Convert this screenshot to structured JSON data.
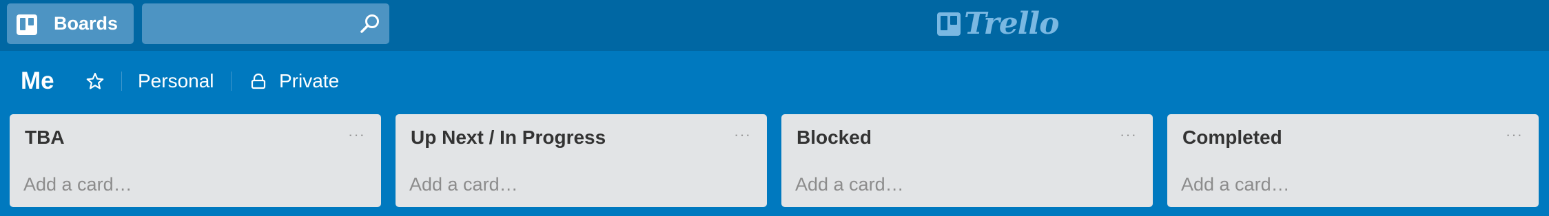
{
  "header": {
    "boards_label": "Boards",
    "search": {
      "value": "",
      "placeholder": ""
    },
    "logo_text": "Trello"
  },
  "board": {
    "title": "Me",
    "team": "Personal",
    "visibility": "Private"
  },
  "lists": [
    {
      "title": "TBA",
      "add_card": "Add a card…",
      "menu": "···"
    },
    {
      "title": "Up Next / In Progress",
      "add_card": "Add a card…",
      "menu": "···"
    },
    {
      "title": "Blocked",
      "add_card": "Add a card…",
      "menu": "···"
    },
    {
      "title": "Completed",
      "add_card": "Add a card…",
      "menu": "···"
    }
  ],
  "colors": {
    "board_background": "#0079bf",
    "header_background": "#0067a3",
    "header_button": "#4d94c3",
    "list_background": "#e2e4e6",
    "logo": "#7ab8e2"
  },
  "icons": {
    "boards": "boards-icon",
    "search": "search-icon",
    "star": "star-icon",
    "lock": "lock-icon",
    "list_menu": "ellipsis-icon"
  }
}
